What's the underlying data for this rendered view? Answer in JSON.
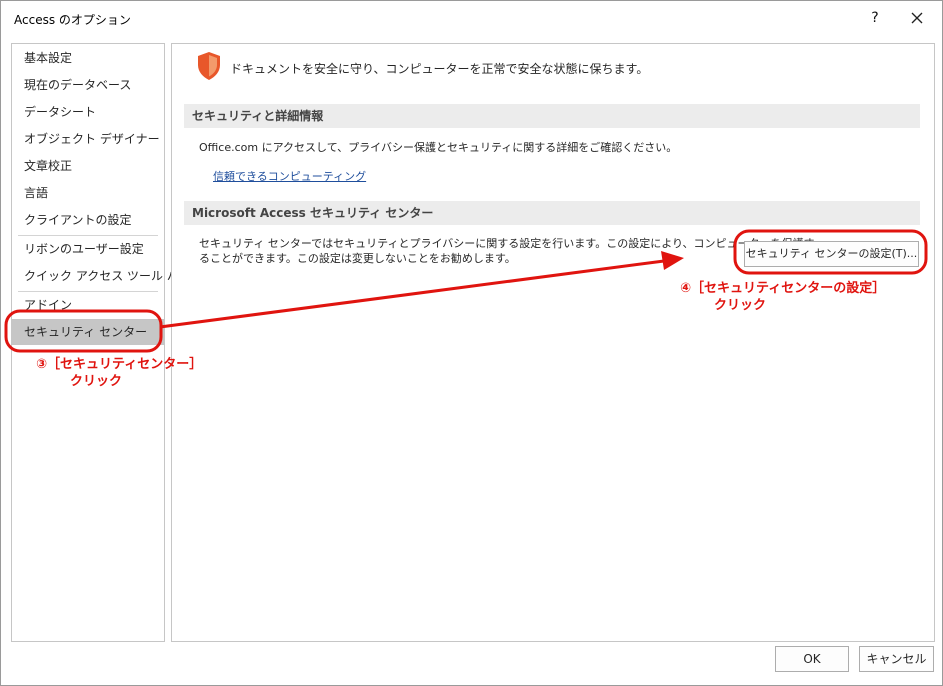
{
  "window": {
    "title": "Access のオプション",
    "help_label": "?"
  },
  "sidebar": {
    "items": [
      {
        "label": "基本設定"
      },
      {
        "label": "現在のデータベース"
      },
      {
        "label": "データシート"
      },
      {
        "label": "オブジェクト デザイナー"
      },
      {
        "label": "文章校正"
      },
      {
        "label": "言語"
      },
      {
        "label": "クライアントの設定"
      },
      {
        "label": "リボンのユーザー設定"
      },
      {
        "label": "クイック アクセス ツール バー"
      },
      {
        "label": "アドイン"
      },
      {
        "label": "セキュリティ センター"
      }
    ],
    "active_index": 10
  },
  "main": {
    "intro": "ドキュメントを安全に守り、コンピューターを正常で安全な状態に保ちます。",
    "section1": {
      "header": "セキュリティと詳細情報",
      "text": "Office.com にアクセスして、プライバシー保護とセキュリティに関する詳細をご確認ください。",
      "link": "信頼できるコンピューティング"
    },
    "section2": {
      "header": "Microsoft Access セキュリティ センター",
      "text_line1": "セキュリティ センターではセキュリティとプライバシーに関する設定を行います。この設定により、コンピューターを保護す",
      "text_line2": "ることができます。この設定は変更しないことをお勧めします。",
      "button": "セキュリティ センターの設定(T)..."
    }
  },
  "footer": {
    "ok": "OK",
    "cancel": "キャンセル"
  },
  "annotations": {
    "step3_line1": "③［セキュリティセンター］",
    "step3_line2": "クリック",
    "step4_line1": "④［セキュリティセンターの設定］",
    "step4_line2": "クリック",
    "color": "#e0140f"
  },
  "colors": {
    "shield": "#e8572a",
    "active_item": "#c6c6c6",
    "section_header": "#ececec",
    "link": "#1f4e9c"
  }
}
